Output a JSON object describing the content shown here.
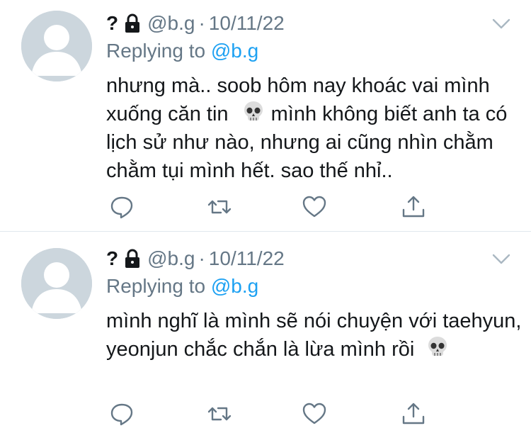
{
  "tweets": [
    {
      "display_name": "?",
      "handle": "@b.g",
      "separator": "·",
      "date": "10/11/22",
      "replying_label": "Replying to",
      "replying_handle": "@b.g",
      "text_part1": "nhưng mà.. soob hôm nay khoác vai mình xuống căn tin",
      "text_part2": " mình không biết anh ta có lịch sử như nào, nhưng ai cũng nhìn chằm chằm tụi mình hết. sao thế nhỉ.."
    },
    {
      "display_name": "?",
      "handle": "@b.g",
      "separator": "·",
      "date": "10/11/22",
      "replying_label": "Replying to",
      "replying_handle": "@b.g",
      "text_part1": "mình nghĩ là mình sẽ nói chuyện với taehyun, yeonjun chắc chắn là lừa mình rồi",
      "text_part2": ""
    }
  ],
  "icons": {
    "lock": "lock-icon",
    "caret": "chevron-down-icon",
    "emoji": "skull-emoji",
    "actions": [
      "reply-icon",
      "retweet-icon",
      "like-icon",
      "share-icon"
    ]
  },
  "colors": {
    "text": "#14171a",
    "secondary": "#657786",
    "link": "#1da1f2",
    "avatar_bg": "#ccd6dd",
    "divider": "#e1e8ed"
  }
}
